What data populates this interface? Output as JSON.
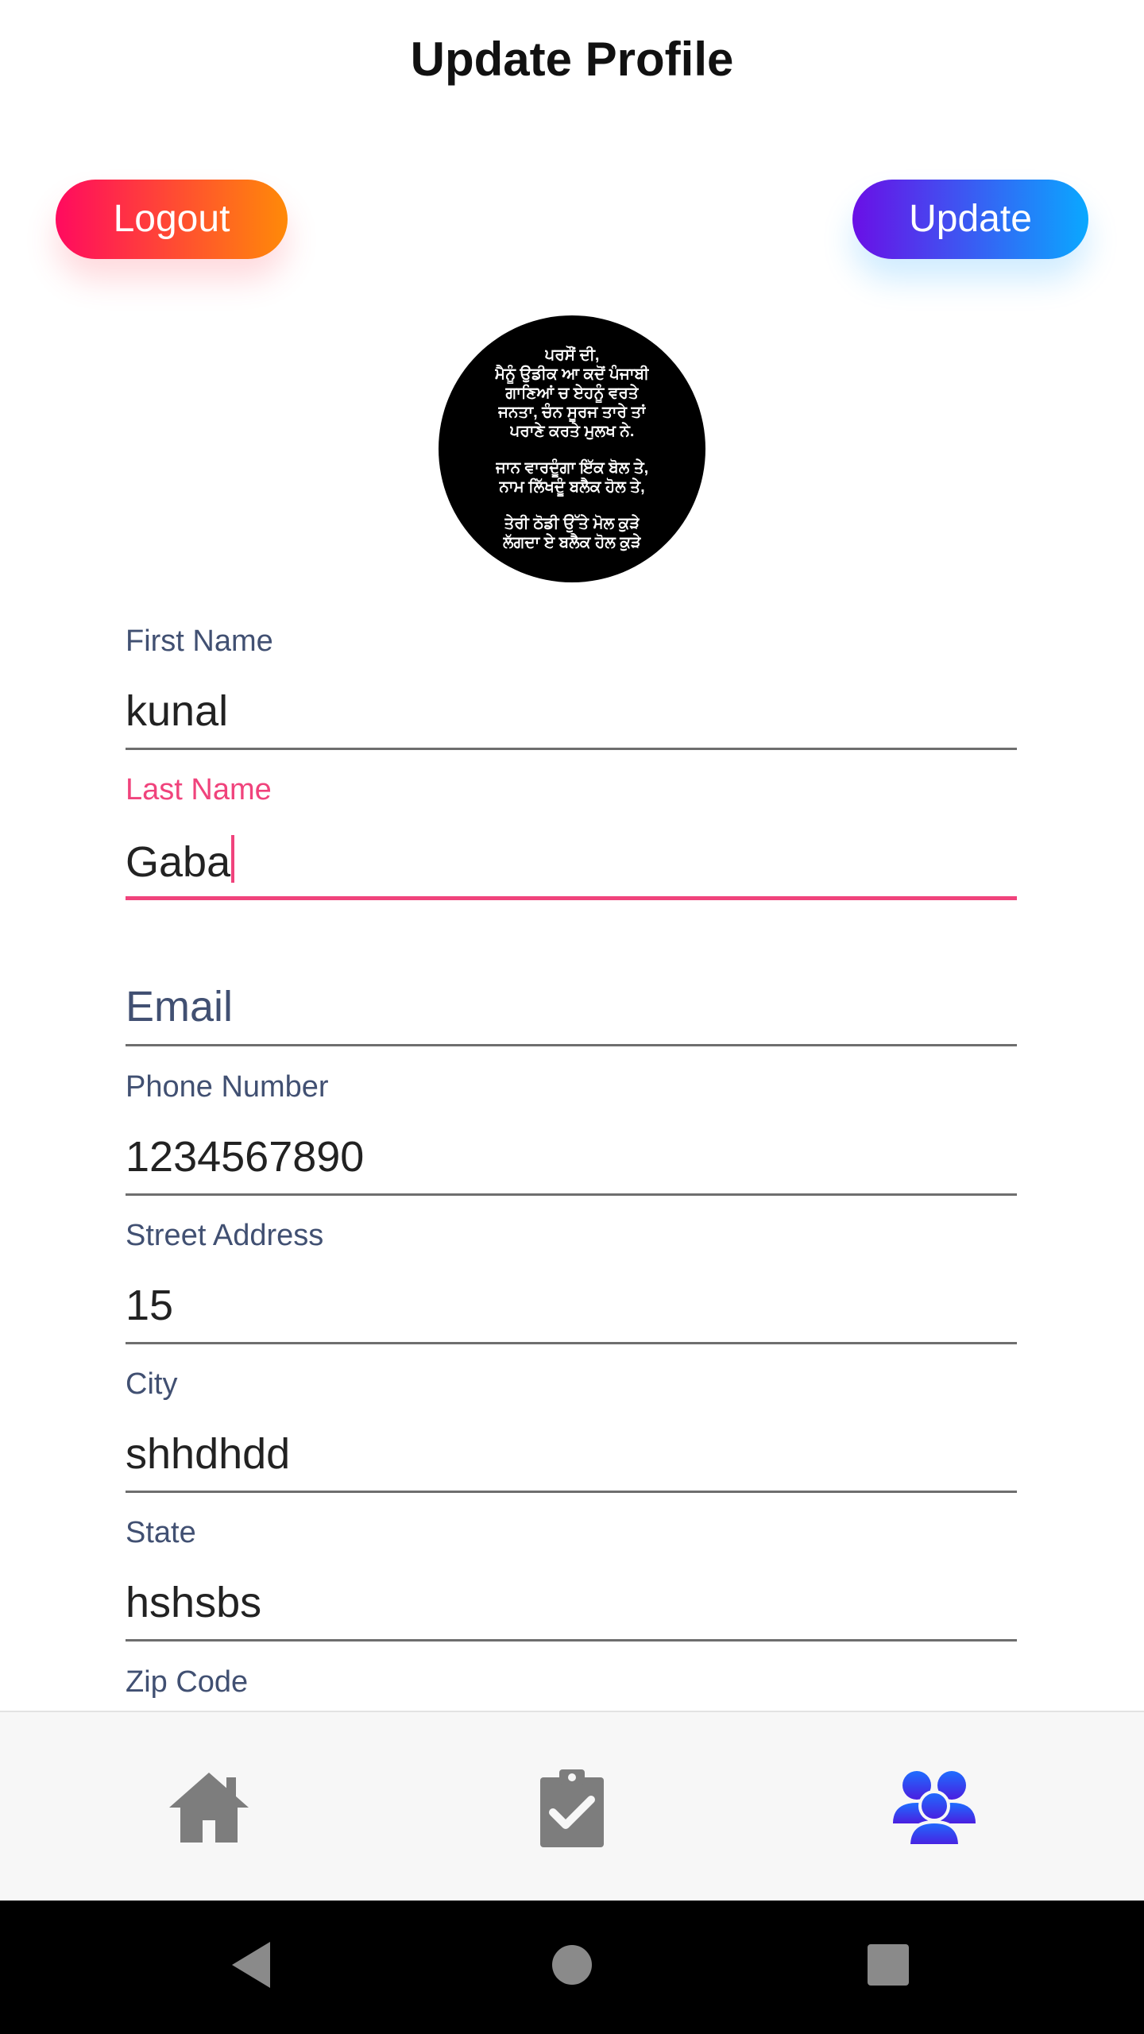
{
  "header": {
    "title": "Update Profile"
  },
  "actions": {
    "logout_label": "Logout",
    "update_label": "Update"
  },
  "avatar": {
    "lines": [
      "ਪਰਸੌਂ ਦੀ,",
      "ਮੈਨੂੰ ਉਡੀਕ ਆ ਕਦੋਂ ਪੰਜਾਬੀ",
      "ਗਾਣਿਆਂ ਚ ਏਹਨੂੰ ਵਰਤੇ",
      "ਜਨਤਾ, ਚੰਨ ਸੂਰਜ ਤਾਰੇ ਤਾਂ",
      "ਪਰਾਣੇ ਕਰਤੇ ਮੁਲਖ ਨੇ.",
      "",
      "ਜਾਨ ਵਾਰਦੂੰਗਾ ਇੱਕ ਬੋਲ ਤੇ,",
      "ਨਾਮ ਲਿੱਖਦੂੰ ਬਲੈਕ ਹੋਲ ਤੇ,",
      "",
      "ਤੇਰੀ ਠੋਡੀ ਉੱਤੇ ਮੋਲ ਕੁੜੇ",
      "ਲੱਗਦਾ ਏ ਬਲੈਕ ਹੋਲ ਕੁੜੇ"
    ]
  },
  "form": {
    "first_name": {
      "label": "First Name",
      "value": "kunal"
    },
    "last_name": {
      "label": "Last Name",
      "value": "Gaba"
    },
    "email": {
      "placeholder": "Email"
    },
    "phone": {
      "label": "Phone Number",
      "value": "1234567890"
    },
    "street": {
      "label": "Street Address",
      "value": "15"
    },
    "city": {
      "label": "City",
      "value": "shhdhdd"
    },
    "state": {
      "label": "State",
      "value": "hshsbs"
    },
    "zip": {
      "label": "Zip Code"
    }
  },
  "tabbar": {
    "active_tab": "profile",
    "inactive_color": "#7d7d7d",
    "active_color_from": "#1e6dff",
    "active_color_to": "#4a1ee0",
    "tabs": [
      {
        "id": "home",
        "icon": "home-icon"
      },
      {
        "id": "tasks",
        "icon": "clipboard-check-icon"
      },
      {
        "id": "profile",
        "icon": "people-icon"
      }
    ]
  },
  "system_nav": {
    "buttons": [
      "back-icon",
      "home-circle-icon",
      "recents-icon"
    ]
  }
}
